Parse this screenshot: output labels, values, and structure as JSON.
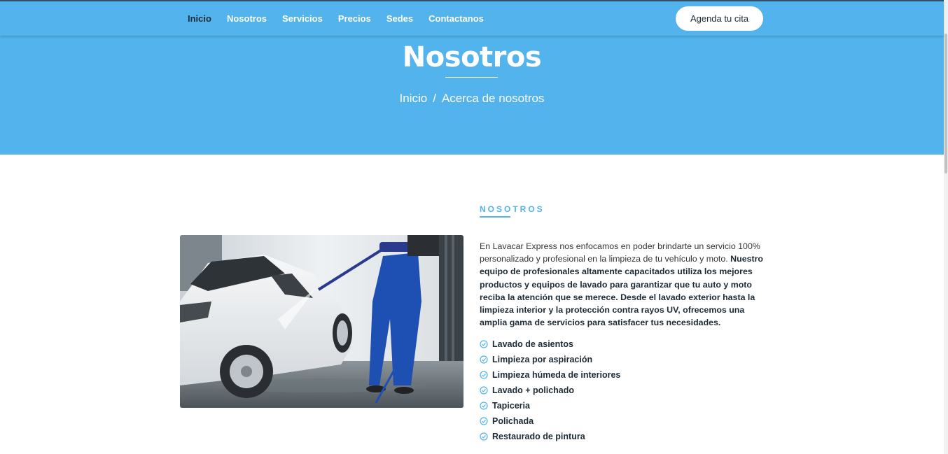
{
  "nav": {
    "links": [
      "Inicio",
      "Nosotros",
      "Servicios",
      "Precios",
      "Sedes",
      "Contactanos"
    ],
    "cta_label": "Agenda tu cita"
  },
  "hero": {
    "title": "Nosotros",
    "breadcrumb": [
      "Inicio",
      "/",
      "Acerca de nosotros"
    ]
  },
  "about": {
    "section_label": "NOSOTROS",
    "paragraph_intro": "En Lavacar Express nos enfocamos en poder brindarte un servicio 100% personalizado y profesional en la limpieza de tu vehículo y moto.",
    "paragraph_bold": "Nuestro equipo de profesionales altamente capacitados utiliza los mejores productos y equipos de lavado para garantizar que tu auto y moto reciba la atención que se merece. Desde el lavado exterior hasta la limpieza interior y la protección contra rayos UV, ofrecemos una amplia gama de servicios para satisfacer tus necesidades.",
    "features": [
      "Lavado de asientos",
      "Limpieza por aspiración",
      "Limpieza húmeda de interiores",
      "Lavado + polichado",
      "Tapiceria",
      "Polichada",
      "Restaurado de pintura"
    ]
  },
  "colors": {
    "brand_blue": "#53b3ec",
    "dark_text": "#1c2b36"
  },
  "icons": {
    "feature_icon": "check-circle-icon"
  }
}
